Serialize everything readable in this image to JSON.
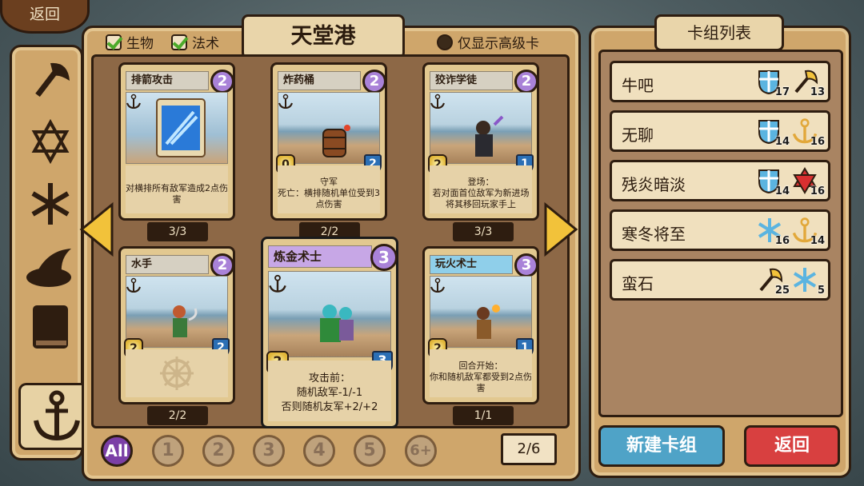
{
  "top_back_label": "返回",
  "title": "天堂港",
  "filters": {
    "creature": "生物",
    "spell": "法术",
    "advanced_only": "仅显示高级卡"
  },
  "cards": [
    {
      "name": "排箭攻击",
      "cost": "2",
      "attack": "",
      "health": "",
      "desc": "对横排所有敌军造成2点伤害",
      "count": "3/3"
    },
    {
      "name": "炸药桶",
      "cost": "2",
      "attack": "0",
      "health": "2",
      "desc": "守军\n死亡：横排随机单位受到3点伤害",
      "count": "2/2"
    },
    {
      "name": "狡诈学徒",
      "cost": "2",
      "attack": "2",
      "health": "1",
      "desc": "登场：\n若对面首位敌军为新进场将其移回玩家手上",
      "count": "3/3"
    },
    {
      "name": "水手",
      "cost": "2",
      "attack": "2",
      "health": "2",
      "desc": "",
      "count": "2/2"
    },
    {
      "name": "炼金术士",
      "cost": "3",
      "attack": "2",
      "health": "3",
      "desc": "攻击前：\n随机敌军-1/-1\n否则随机友军+2/+2",
      "count": ""
    },
    {
      "name": "玩火术士",
      "cost": "3",
      "attack": "2",
      "health": "1",
      "desc": "回合开始：\n你和随机敌军都受到2点伤害",
      "count": "1/1"
    }
  ],
  "pager": [
    "All",
    "1",
    "2",
    "3",
    "4",
    "5",
    "6+"
  ],
  "page_indicator": "2/6",
  "deck_list_title": "卡组列表",
  "decks": [
    {
      "name": "牛吧",
      "icons": [
        {
          "icon": "shield-icon",
          "n": "17"
        },
        {
          "icon": "axe-icon",
          "n": "13"
        }
      ]
    },
    {
      "name": "无聊",
      "icons": [
        {
          "icon": "shield-icon",
          "n": "14"
        },
        {
          "icon": "anchor-icon",
          "n": "16"
        }
      ]
    },
    {
      "name": "残炎暗淡",
      "icons": [
        {
          "icon": "shield-icon",
          "n": "14"
        },
        {
          "icon": "star-icon",
          "n": "16"
        }
      ]
    },
    {
      "name": "寒冬将至",
      "icons": [
        {
          "icon": "snowflake-icon",
          "n": "16"
        },
        {
          "icon": "anchor-icon",
          "n": "14"
        }
      ]
    },
    {
      "name": "蛮石",
      "icons": [
        {
          "icon": "axe-icon",
          "n": "25"
        },
        {
          "icon": "snowflake-icon",
          "n": "5"
        }
      ]
    }
  ],
  "new_deck_label": "新建卡组",
  "back_label": "返回",
  "colors": {
    "new_deck": "#4fa3c7",
    "back": "#d84040",
    "purple": "#a982d8",
    "blue": "#5bb4e0"
  }
}
